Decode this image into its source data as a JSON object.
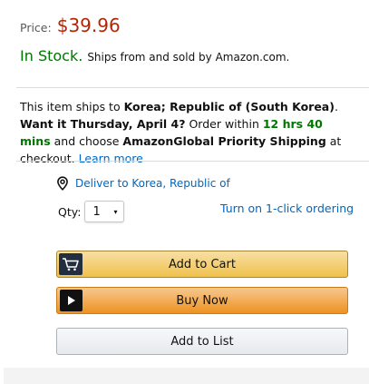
{
  "price": {
    "label": "Price:",
    "value": "$39.96"
  },
  "stock": {
    "status": "In Stock.",
    "ships_from": "Ships from and sold by Amazon.com."
  },
  "shipping": {
    "intro": "This item ships to ",
    "destination": "Korea; Republic of (South Korea)",
    "sep": ". ",
    "want_it": "Want it Thursday, April 4?",
    "order_within": " Order within ",
    "countdown": "12 hrs 40 mins",
    "and_choose": " and choose ",
    "method": "AmazonGlobal Priority Shipping",
    "at_checkout": " at checkout. ",
    "learn_more": "Learn more"
  },
  "deliver": {
    "icon": "location-pin-icon",
    "label": "Deliver to Korea, Republic of"
  },
  "quantity": {
    "label": "Qty:",
    "selected": "1",
    "caret": "▾"
  },
  "oneclick": {
    "label": "Turn on 1-click ordering"
  },
  "buttons": {
    "add_to_cart": "Add to Cart",
    "buy_now": "Buy Now",
    "add_to_list": "Add to List"
  },
  "colors": {
    "price": "#B12704",
    "in_stock": "#007600",
    "link": "#0066c0",
    "cart_button": "#f0c14b",
    "buy_button": "#ed9220"
  }
}
